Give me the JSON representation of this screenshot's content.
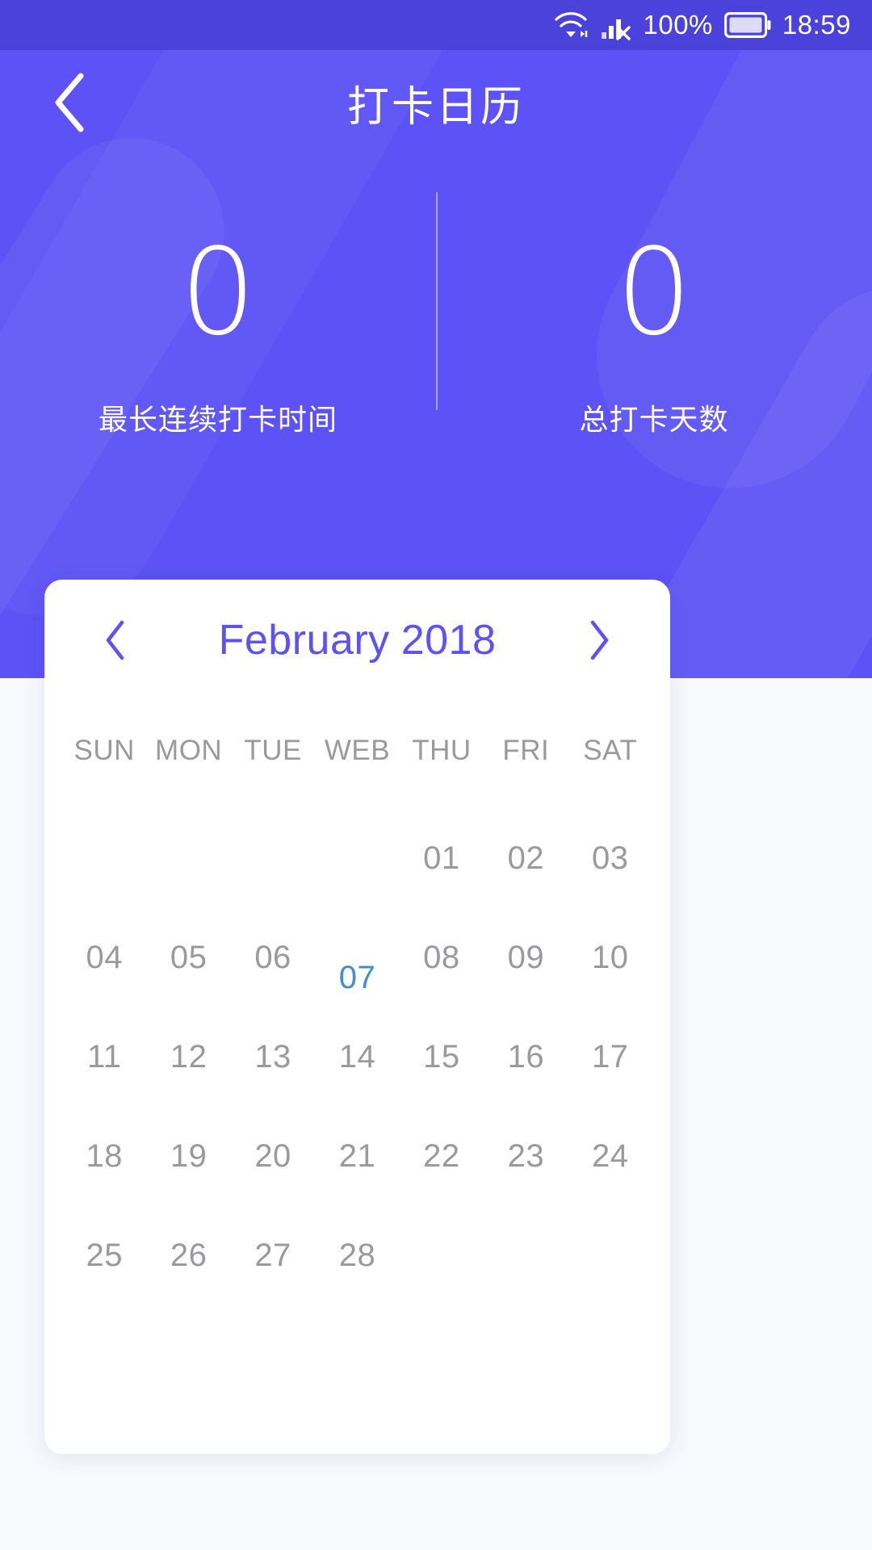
{
  "status_bar": {
    "battery_percent": "100%",
    "time": "18:59",
    "icons": [
      "wifi-icon",
      "signal-no-sim-icon",
      "battery-icon"
    ]
  },
  "header": {
    "title": "打卡日历",
    "back_icon": "chevron-left-icon"
  },
  "stats": [
    {
      "value": "0",
      "label": "最长连续打卡时间"
    },
    {
      "value": "0",
      "label": "总打卡天数"
    }
  ],
  "calendar": {
    "prev_icon": "chevron-left-icon",
    "next_icon": "chevron-right-icon",
    "month": "February",
    "year": "2018",
    "weekdays": [
      "SUN",
      "MON",
      "TUE",
      "WEB",
      "THU",
      "FRI",
      "SAT"
    ],
    "leading_blanks": 4,
    "days": [
      "01",
      "02",
      "03",
      "04",
      "05",
      "06",
      "07",
      "08",
      "09",
      "10",
      "11",
      "12",
      "13",
      "14",
      "15",
      "16",
      "17",
      "18",
      "19",
      "20",
      "21",
      "22",
      "23",
      "24",
      "25",
      "26",
      "27",
      "28"
    ],
    "today": "07"
  },
  "colors": {
    "hero_purple": "#5c52f5",
    "status_bar_purple": "#4a42db",
    "accent_blue": "#5c52f5",
    "today_blue": "#3d8fcd",
    "day_gray": "#9a9a9e",
    "page_bg": "#f8f9fd",
    "card_bg": "#ffffff"
  }
}
